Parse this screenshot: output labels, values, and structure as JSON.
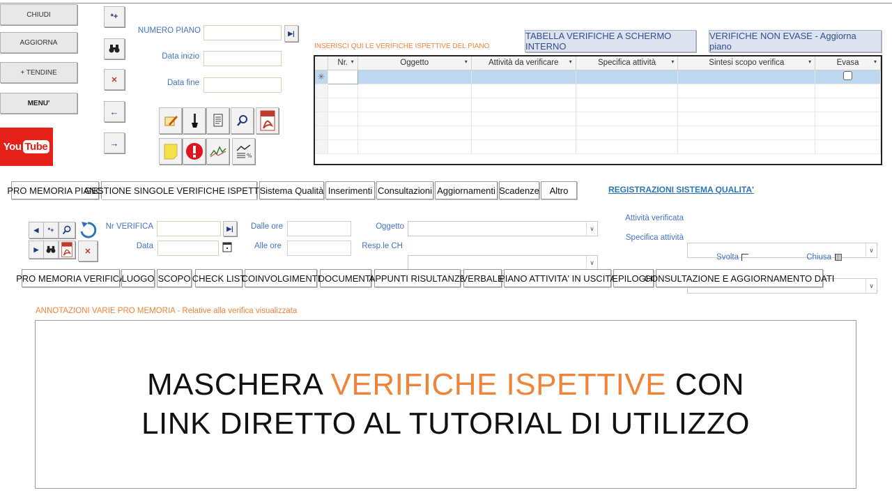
{
  "left_buttons": {
    "chiudi": "CHIUDI",
    "aggiorna": "AGGIORNA",
    "tendine": "+ TENDINE",
    "menu": "MENU'"
  },
  "youtube": {
    "you": "You",
    "tube": "Tube"
  },
  "nav_buttons": {
    "new": "*+",
    "find": "▲▲",
    "delete": "✕",
    "back": "←",
    "forward": "→"
  },
  "piano": {
    "numero_label": "NUMERO PIANO",
    "data_inizio_label": "Data inizio",
    "data_fine_label": "Data fine",
    "numero_value": "",
    "data_inizio_value": "",
    "data_fine_value": ""
  },
  "header_buttons": {
    "tabella": "TABELLA VERIFICHE A SCHERMO INTERNO",
    "non_evase": "VERIFICHE NON EVASE - Aggiorna piano"
  },
  "grid": {
    "caption": "INSERISCI QUI LE VERIFICHE ISPETTIVE DEL PIANO",
    "columns": [
      "Nr.",
      "Oggetto",
      "Attività da verificare",
      "Specifica attività",
      "Sintesi scopo verifica",
      "Evasa"
    ],
    "new_row_marker": "✳"
  },
  "main_tabs": [
    "PRO MEMORIA PIANO",
    "GESTIONE SINGOLE VERIFICHE ISPETTIVE",
    "Sistema Qualità",
    "Inserimenti",
    "Consultazioni",
    "Aggiornamenti",
    "Scadenze",
    "Altro"
  ],
  "registrazioni_link": "REGISTRAZIONI SISTEMA QUALITA'",
  "verifica": {
    "nr_label": "Nr VERIFICA",
    "data_label": "Data",
    "dalle_label": "Dalle ore",
    "alle_label": "Alle ore",
    "oggetto_label": "Oggetto",
    "resp_label": "Resp.le CH",
    "attivita_label": "Attività verificata",
    "specifica_label": "Specifica attività",
    "svolta_label": "Svolta",
    "chiusa_label": "Chiusa"
  },
  "sub_tabs": [
    "PRO MEMORIA VERIFICA",
    "LUOGO",
    "SCOPO",
    "CHECK LIST",
    "COINVOLGIMENTI",
    "DOCUMENTI",
    "APPUNTI RISULTANZE",
    "VERBALE",
    "PIANO ATTIVITA' IN USCITA",
    "EPILOGHI",
    "CONSULTAZIONE E AGGIORNAMENTO DATI"
  ],
  "annotazioni_label": "ANNOTAZIONI VARIE PRO MEMORIA - Relative alla verifica visualizzata",
  "overlay": {
    "line1_a": "MASCHERA ",
    "line1_b": "VERIFICHE ISPETTIVE",
    "line1_c": " CON",
    "line2": "LINK DIRETTO AL TUTORIAL DI UTILIZZO"
  },
  "colors": {
    "accent_orange": "#f0833a",
    "label_blue": "#4472c4",
    "youtube_red": "#e62117",
    "selection_blue": "#bdd7ee"
  }
}
